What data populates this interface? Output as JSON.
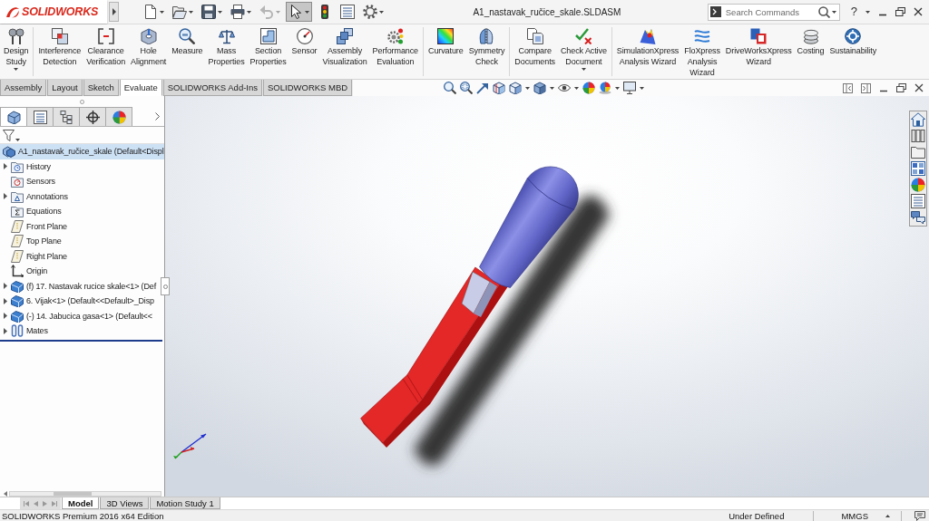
{
  "title_bar": {
    "logo": "SOLIDWORKS",
    "quick_access": [
      {
        "dropdown": true,
        "selected": false,
        "disabled": false
      },
      {
        "dropdown": true,
        "selected": false,
        "disabled": false
      },
      {
        "dropdown": true,
        "selected": false,
        "disabled": false
      },
      {
        "dropdown": true,
        "selected": false,
        "disabled": false
      },
      {
        "dropdown": true,
        "selected": false,
        "disabled": true
      },
      {
        "dropdown": true,
        "selected": true,
        "disabled": false
      },
      {
        "dropdown": false,
        "selected": false,
        "disabled": false
      },
      {
        "dropdown": false,
        "selected": false,
        "disabled": false
      },
      {
        "dropdown": true,
        "selected": false,
        "disabled": false
      }
    ],
    "title": "A1_nastavak_ručice_skale.SLDASM",
    "search": {
      "placeholder": "Search Commands"
    },
    "help": "?"
  },
  "ribbon": {
    "groups": [
      [
        {
          "lines": [
            "Design",
            "Study"
          ],
          "dropdown": true
        }
      ],
      [
        {
          "lines": [
            "Interference",
            "Detection"
          ],
          "dropdown": false
        },
        {
          "lines": [
            "Clearance",
            "Verification"
          ],
          "dropdown": false
        },
        {
          "lines": [
            "Hole",
            "Alignment"
          ],
          "dropdown": false
        },
        {
          "lines": [
            "Measure"
          ],
          "dropdown": false
        },
        {
          "lines": [
            "Mass",
            "Properties"
          ],
          "dropdown": false
        },
        {
          "lines": [
            "Section",
            "Properties"
          ],
          "dropdown": false
        },
        {
          "lines": [
            "Sensor"
          ],
          "dropdown": false
        },
        {
          "lines": [
            "Assembly",
            "Visualization"
          ],
          "dropdown": false
        },
        {
          "lines": [
            "Performance",
            "Evaluation"
          ],
          "dropdown": false
        }
      ],
      [
        {
          "lines": [
            "Curvature"
          ],
          "dropdown": false
        },
        {
          "lines": [
            "Symmetry",
            "Check"
          ],
          "dropdown": false
        }
      ],
      [
        {
          "lines": [
            "Compare",
            "Documents"
          ],
          "dropdown": false
        },
        {
          "lines": [
            "Check Active",
            "Document"
          ],
          "dropdown": true
        }
      ],
      [
        {
          "lines": [
            "SimulationXpress",
            "Analysis Wizard"
          ],
          "dropdown": false
        },
        {
          "lines": [
            "FloXpress",
            "Analysis",
            "Wizard"
          ],
          "dropdown": false
        },
        {
          "lines": [
            "DriveWorksXpress",
            "Wizard"
          ],
          "dropdown": false
        },
        {
          "lines": [
            "Costing"
          ],
          "dropdown": false
        },
        {
          "lines": [
            "Sustainability"
          ],
          "dropdown": false
        }
      ]
    ]
  },
  "command_tabs": [
    {
      "label": "Assembly",
      "selected": false
    },
    {
      "label": "Layout",
      "selected": false
    },
    {
      "label": "Sketch",
      "selected": false
    },
    {
      "label": "Evaluate",
      "selected": true
    },
    {
      "label": "SOLIDWORKS Add-Ins",
      "selected": false
    },
    {
      "label": "SOLIDWORKS MBD",
      "selected": false
    }
  ],
  "feature_panel": {
    "tabs": [
      {
        "selected": true
      },
      {
        "selected": false
      },
      {
        "selected": false
      },
      {
        "selected": false
      },
      {
        "selected": false
      }
    ],
    "tree": {
      "label": "A1_nastavak_ručice_skale (Default<Displ",
      "selected": true,
      "children": [
        {
          "label": "History",
          "kind": "history",
          "expandable": true,
          "selected": false
        },
        {
          "label": "Sensors",
          "kind": "sensors",
          "expandable": false,
          "selected": false
        },
        {
          "label": "Annotations",
          "kind": "annotations",
          "expandable": true,
          "selected": false
        },
        {
          "label": "Equations",
          "kind": "equations",
          "expandable": false,
          "selected": false
        },
        {
          "label": "Front Plane",
          "kind": "plane",
          "expandable": false,
          "selected": false
        },
        {
          "label": "Top Plane",
          "kind": "plane",
          "expandable": false,
          "selected": false
        },
        {
          "label": "Right Plane",
          "kind": "plane",
          "expandable": false,
          "selected": false
        },
        {
          "label": "Origin",
          "kind": "origin",
          "expandable": false,
          "selected": false
        },
        {
          "label": "(f) 17. Nastavak rucice skale<1> (Def",
          "kind": "component",
          "expandable": true,
          "selected": false
        },
        {
          "label": "6. Vijak<1> (Default<<Default>_Disp",
          "kind": "component",
          "expandable": true,
          "selected": false
        },
        {
          "label": "(-) 14. Jabucica gasa<1> (Default<<",
          "kind": "component",
          "expandable": true,
          "selected": false
        },
        {
          "label": "Mates",
          "kind": "mates",
          "expandable": true,
          "selected": false
        }
      ]
    }
  },
  "bottom_tabs": [
    {
      "label": "Model",
      "selected": true
    },
    {
      "label": "3D Views",
      "selected": false
    },
    {
      "label": "Motion Study 1",
      "selected": false
    }
  ],
  "status_bar": {
    "edition": "SOLIDWORKS Premium 2016 x64 Edition",
    "state": "Under Defined",
    "units": "MMGS"
  }
}
